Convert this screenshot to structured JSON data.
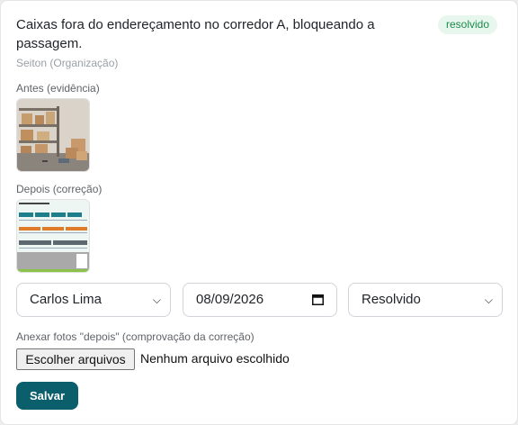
{
  "issue": {
    "title": "Caixas fora do endereçamento no corredor A, bloqueando a passagem.",
    "status_badge": "resolvido",
    "category": "Seiton (Organização)"
  },
  "evidence": {
    "before_label": "Antes (evidência)",
    "after_label": "Depois (correção)"
  },
  "form": {
    "responsible": "Carlos Lima",
    "date": "08/09/2026",
    "status": "Resolvido",
    "upload_label": "Anexar fotos \"depois\" (comprovação da correção)",
    "file_button": "Escolher arquivos",
    "file_status": "Nenhum arquivo escolhido",
    "save_button": "Salvar"
  },
  "colors": {
    "primary": "#0b5e6b",
    "badge_bg": "#e7f7ee",
    "badge_text": "#1e8a4c"
  }
}
